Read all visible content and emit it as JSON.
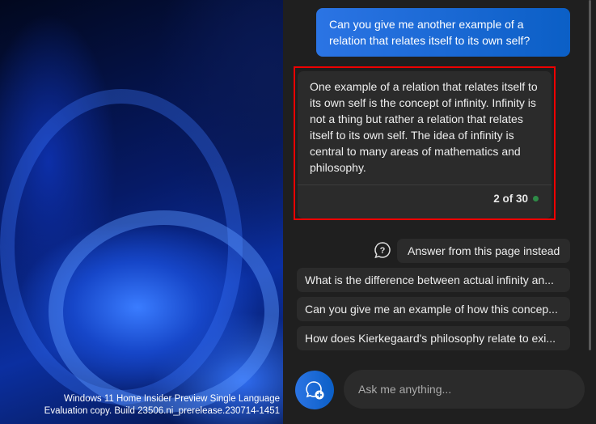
{
  "desktop": {
    "watermark_line1": "Windows 11 Home Insider Preview Single Language",
    "watermark_line2": "Evaluation copy. Build 23506.ni_prerelease.230714-1451"
  },
  "chat": {
    "user_message": "Can you give me another example of a relation that relates itself to its own self?",
    "assistant_message": "One example of a relation that relates itself to its own self is the concept of infinity. Infinity is not a thing but rather a relation that relates itself to its own self. The idea of infinity is central to many areas of mathematics and philosophy.",
    "turn_counter": "2 of 30",
    "status_color": "#2e8b47",
    "answer_from_page": "Answer from this page instead",
    "suggestions": [
      "What is the difference between actual infinity an...",
      "Can you give me an example of how this concep...",
      "How does Kierkegaard's philosophy relate to exi..."
    ],
    "input_placeholder": "Ask me anything..."
  }
}
